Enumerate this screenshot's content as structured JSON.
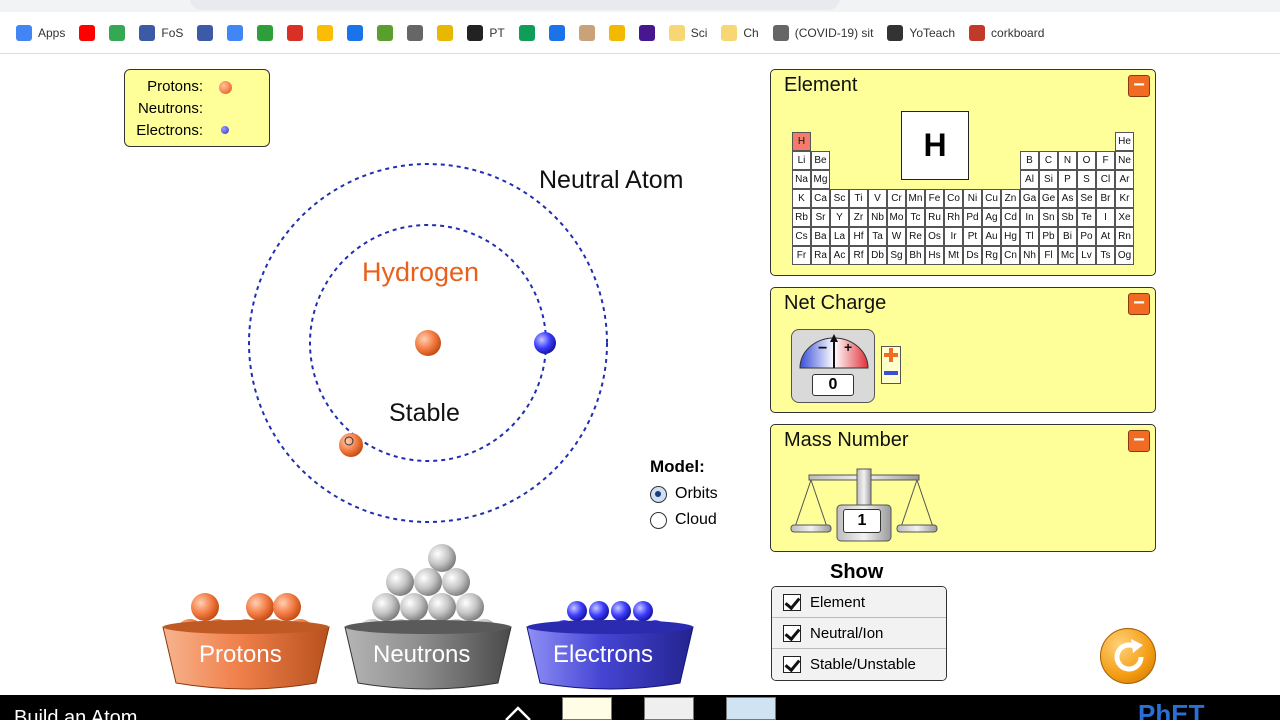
{
  "bookmarks": [
    {
      "label": "Apps",
      "icon": "apps-grid-icon",
      "color": "#4285f4"
    },
    {
      "label": "",
      "icon": "youtube-icon",
      "color": "#ff0000"
    },
    {
      "label": "",
      "icon": "maps-icon",
      "color": "#34a853"
    },
    {
      "label": "FoS",
      "icon": "fos-icon",
      "color": "#3c5aa6"
    },
    {
      "label": "",
      "icon": "classroom-icon",
      "color": "#3c5aa6"
    },
    {
      "label": "",
      "icon": "calendar-icon",
      "color": "#4285f4"
    },
    {
      "label": "",
      "icon": "tss-icon",
      "color": "#2e9e3a"
    },
    {
      "label": "",
      "icon": "gmail-icon",
      "color": "#d93025"
    },
    {
      "label": "",
      "icon": "drive-icon",
      "color": "#fbbc04"
    },
    {
      "label": "",
      "icon": "pencil-icon",
      "color": "#1a73e8"
    },
    {
      "label": "",
      "icon": "photo-icon",
      "color": "#5a9e2e"
    },
    {
      "label": "",
      "icon": "r-icon",
      "color": "#666666"
    },
    {
      "label": "",
      "icon": "bookmark-icon",
      "color": "#e8b800"
    },
    {
      "label": "PT",
      "icon": "github-icon",
      "color": "#222222"
    },
    {
      "label": "",
      "icon": "cloud-icon",
      "color": "#0f9d58"
    },
    {
      "label": "",
      "icon": "p-icon",
      "color": "#1a73e8"
    },
    {
      "label": "",
      "icon": "brain-icon",
      "color": "#c9a27a"
    },
    {
      "label": "",
      "icon": "bird-icon",
      "color": "#f2b900"
    },
    {
      "label": "",
      "icon": "kahoot-icon",
      "color": "#46178f"
    },
    {
      "label": "Sci",
      "icon": "folder-icon",
      "color": "#f6d774"
    },
    {
      "label": "Ch",
      "icon": "folder-icon",
      "color": "#f6d774"
    },
    {
      "label": "(COVID-19) sit",
      "icon": "virus-icon",
      "color": "#666666"
    },
    {
      "label": "YoTeach",
      "icon": "yoteach-icon",
      "color": "#333333"
    },
    {
      "label": "corkboard",
      "icon": "star-icon",
      "color": "#c0392b"
    }
  ],
  "legend": {
    "protons_label": "Protons:",
    "neutrons_label": "Neutrons:",
    "electrons_label": "Electrons:",
    "proton_color": "#f37d46",
    "electron_color": "#3333cc"
  },
  "atom": {
    "neutral_label": "Neutral Atom",
    "element_name": "Hydrogen",
    "element_name_color": "#e8601c",
    "stability_label": "Stable",
    "orbit_color": "#1f2fb0"
  },
  "model": {
    "title": "Model:",
    "options": [
      {
        "label": "Orbits",
        "selected": true
      },
      {
        "label": "Cloud",
        "selected": false
      }
    ]
  },
  "element_panel": {
    "title": "Element",
    "collapse_symbol": "−",
    "selected_symbol": "H",
    "rows": [
      [
        "H",
        "",
        "",
        "",
        "",
        "",
        "",
        "",
        "",
        "",
        "",
        "",
        "",
        "",
        "",
        "",
        "",
        "He"
      ],
      [
        "Li",
        "Be",
        "",
        "",
        "",
        "",
        "",
        "",
        "",
        "",
        "",
        "",
        "B",
        "C",
        "N",
        "O",
        "F",
        "Ne"
      ],
      [
        "Na",
        "Mg",
        "",
        "",
        "",
        "",
        "",
        "",
        "",
        "",
        "",
        "",
        "Al",
        "Si",
        "P",
        "S",
        "Cl",
        "Ar"
      ],
      [
        "K",
        "Ca",
        "Sc",
        "Ti",
        "V",
        "Cr",
        "Mn",
        "Fe",
        "Co",
        "Ni",
        "Cu",
        "Zn",
        "Ga",
        "Ge",
        "As",
        "Se",
        "Br",
        "Kr"
      ],
      [
        "Rb",
        "Sr",
        "Y",
        "Zr",
        "Nb",
        "Mo",
        "Tc",
        "Ru",
        "Rh",
        "Pd",
        "Ag",
        "Cd",
        "In",
        "Sn",
        "Sb",
        "Te",
        "I",
        "Xe"
      ],
      [
        "Cs",
        "Ba",
        "La",
        "Hf",
        "Ta",
        "W",
        "Re",
        "Os",
        "Ir",
        "Pt",
        "Au",
        "Hg",
        "Tl",
        "Pb",
        "Bi",
        "Po",
        "At",
        "Rn"
      ],
      [
        "Fr",
        "Ra",
        "Ac",
        "Rf",
        "Db",
        "Sg",
        "Bh",
        "Hs",
        "Mt",
        "Ds",
        "Rg",
        "Cn",
        "Nh",
        "Fl",
        "Mc",
        "Lv",
        "Ts",
        "Og"
      ]
    ]
  },
  "charge_panel": {
    "title": "Net Charge",
    "collapse_symbol": "−",
    "value": "0",
    "minus_sign": "−",
    "plus_sign": "+"
  },
  "mass_panel": {
    "title": "Mass Number",
    "collapse_symbol": "−",
    "value": "1"
  },
  "show": {
    "title": "Show",
    "items": [
      {
        "label": "Element",
        "checked": true
      },
      {
        "label": "Neutral/Ion",
        "checked": true
      },
      {
        "label": "Stable/Unstable",
        "checked": true
      }
    ]
  },
  "buckets": {
    "protons": "Protons",
    "neutrons": "Neutrons",
    "electrons": "Electrons",
    "proton_color": "#f08048",
    "neutron_color": "#8a8a8a",
    "electron_color": "#3b3bcc"
  },
  "taskbar": {
    "title": "Build an Atom",
    "logo": "PhET"
  }
}
